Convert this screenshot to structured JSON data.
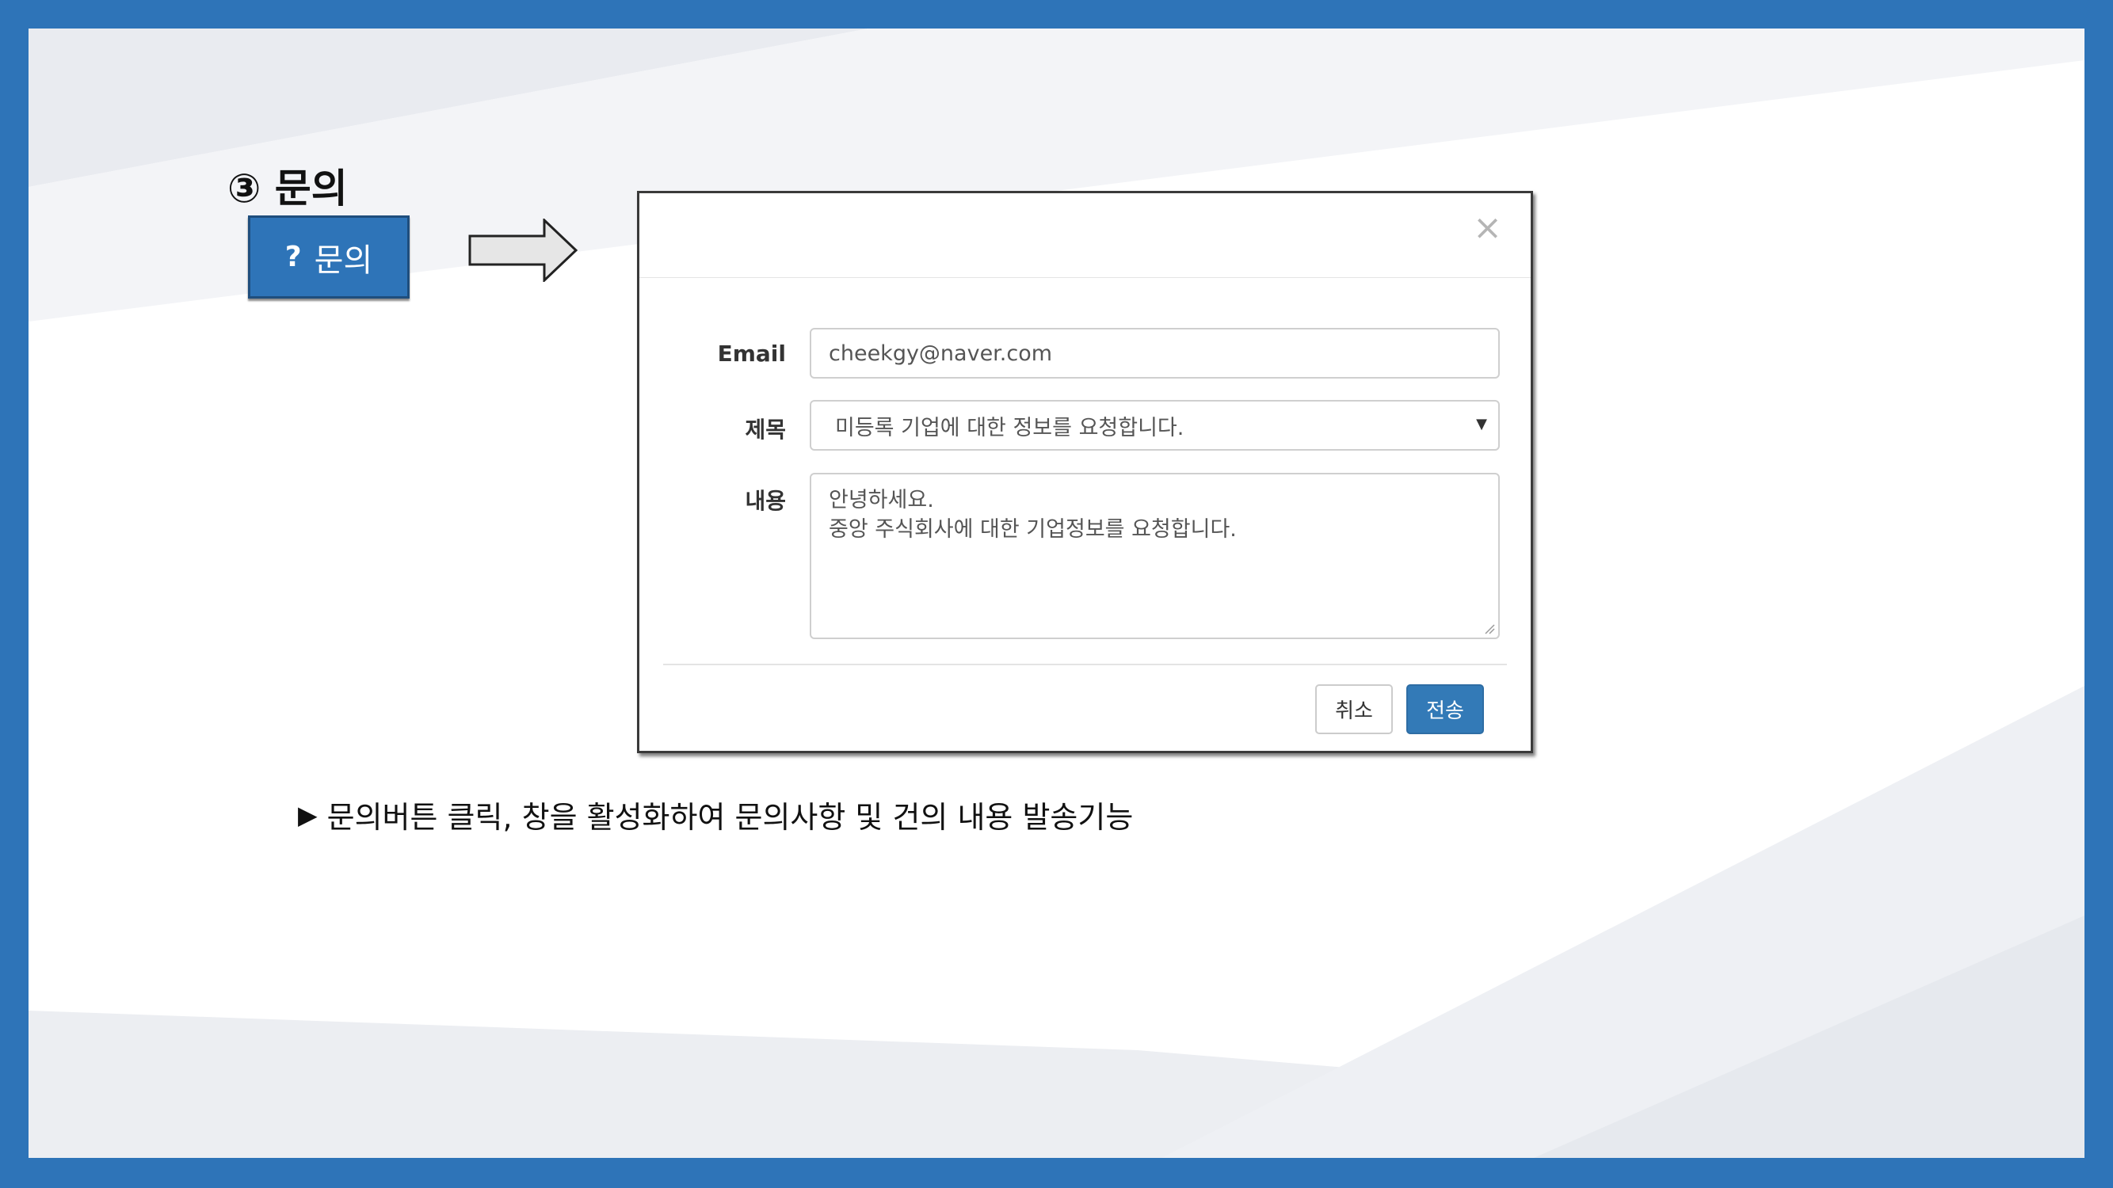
{
  "section": {
    "title": "③ 문의"
  },
  "inquiry_button": {
    "icon_glyph": "?",
    "label": "문의"
  },
  "modal": {
    "close_glyph": "×",
    "email_label": "Email",
    "email_value": "cheekgy@naver.com",
    "subject_label": "제목",
    "subject_value": "미등록 기업에 대한 정보를 요청합니다.",
    "content_label": "내용",
    "content_line1": "안녕하세요.",
    "content_line2": "중앙 주식회사에 대한 기업정보를 요청합니다.",
    "cancel_label": "취소",
    "send_label": "전송"
  },
  "caption": {
    "bullet": "▶",
    "text": "문의버튼 클릭, 창을 활성화하여 문의사항 및 건의 내용 발송기능"
  },
  "colors": {
    "frame_blue": "#2e74b8",
    "primary_button": "#337ab7"
  },
  "icons": {
    "arrow": "right-arrow-icon",
    "close": "close-icon",
    "caret": "caret-down-icon",
    "question": "question-mark-icon"
  }
}
